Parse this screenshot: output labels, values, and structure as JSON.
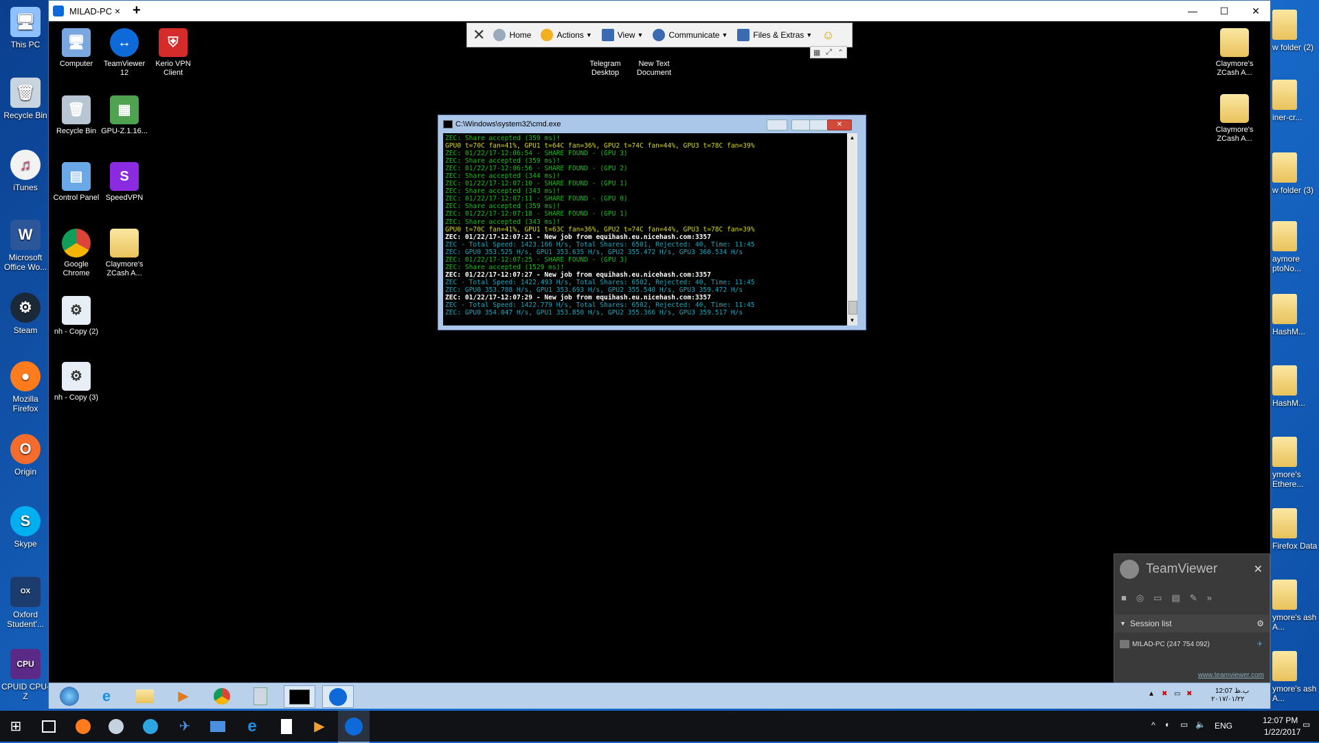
{
  "local_desktop": {
    "left_icons": [
      "This PC",
      "Recycle Bin",
      "iTunes",
      "Microsoft Office Wo...",
      "Steam",
      "Mozilla Firefox",
      "Origin",
      "Skype",
      "Oxford Student'...",
      "CPUID CPU-Z"
    ],
    "right_icons": [
      "w folder (2)",
      "iner-cr...",
      "w folder (3)",
      "aymore ptoNo...",
      "HashM...",
      "HashM...",
      "ymore's Ethere...",
      "Firefox Data",
      "ymore's ash A...",
      "ymore's ash A..."
    ]
  },
  "tv_window": {
    "tab_title": "MILAD-PC",
    "tab_close": "×",
    "new_tab": "+",
    "minimize": "—",
    "maximize": "☐",
    "close": "✕"
  },
  "tv_toolbar": {
    "items": [
      "Home",
      "Actions",
      "View",
      "Communicate",
      "Files & Extras"
    ],
    "smiley": "☺"
  },
  "remote_desktop": {
    "icons": [
      {
        "label": "Computer"
      },
      {
        "label": "TeamViewer 12"
      },
      {
        "label": "Kerio VPN Client"
      },
      {
        "label": "Recycle Bin"
      },
      {
        "label": "GPU-Z.1.16..."
      },
      {
        "label": "Control Panel"
      },
      {
        "label": "SpeedVPN"
      },
      {
        "label": "Google Chrome"
      },
      {
        "label": "Claymore's ZCash A..."
      },
      {
        "label": "nh - Copy (2)"
      },
      {
        "label": "nh - Copy (3)"
      },
      {
        "label": "Telegram Desktop"
      },
      {
        "label": "New Text Document"
      },
      {
        "label": "Claymore's ZCash A..."
      },
      {
        "label": "Claymore's ZCash A..."
      }
    ]
  },
  "cmd": {
    "title": "C:\\Windows\\system32\\cmd.exe",
    "lines": [
      {
        "c": "green",
        "t": "ZEC: Share accepted (359 ms)!"
      },
      {
        "c": "yellow",
        "t": "GPU0 t=70C fan=41%, GPU1 t=64C fan=36%, GPU2 t=74C fan=44%, GPU3 t=78C fan=39%"
      },
      {
        "c": "green",
        "t": "ZEC: 01/22/17-12:06:54 - SHARE FOUND - (GPU 3)"
      },
      {
        "c": "green",
        "t": "ZEC: Share accepted (359 ms)!"
      },
      {
        "c": "green",
        "t": "ZEC: 01/22/17-12:06:56 - SHARE FOUND - (GPU 2)"
      },
      {
        "c": "green",
        "t": "ZEC: Share accepted (344 ms)!"
      },
      {
        "c": "green",
        "t": "ZEC: 01/22/17-12:07:10 - SHARE FOUND - (GPU 1)"
      },
      {
        "c": "green",
        "t": "ZEC: Share accepted (343 ms)!"
      },
      {
        "c": "green",
        "t": "ZEC: 01/22/17-12:07:11 - SHARE FOUND - (GPU 0)"
      },
      {
        "c": "green",
        "t": "ZEC: Share accepted (359 ms)!"
      },
      {
        "c": "green",
        "t": "ZEC: 01/22/17-12:07:18 - SHARE FOUND - (GPU 1)"
      },
      {
        "c": "green",
        "t": "ZEC: Share accepted (343 ms)!"
      },
      {
        "c": "yellow",
        "t": "GPU0 t=70C fan=41%, GPU1 t=63C fan=36%, GPU2 t=74C fan=44%, GPU3 t=78C fan=39%"
      },
      {
        "c": "white",
        "t": "ZEC: 01/22/17-12:07:21 - New job from equihash.eu.nicehash.com:3357"
      },
      {
        "c": "cyan",
        "t": "ZEC - Total Speed: 1423.166 H/s, Total Shares: 6501, Rejected: 40, Time: 11:45"
      },
      {
        "c": "cyan",
        "t": "ZEC: GPU0 353.525 H/s, GPU1 353.635 H/s, GPU2 355.472 H/s, GPU3 360.534 H/s"
      },
      {
        "c": "green",
        "t": "ZEC: 01/22/17-12:07:25 - SHARE FOUND - (GPU 3)"
      },
      {
        "c": "green",
        "t": "ZEC: Share accepted (1529 ms)!"
      },
      {
        "c": "white",
        "t": "ZEC: 01/22/17-12:07:27 - New job from equihash.eu.nicehash.com:3357"
      },
      {
        "c": "cyan",
        "t": "ZEC - Total Speed: 1422.493 H/s, Total Shares: 6502, Rejected: 40, Time: 11:45"
      },
      {
        "c": "cyan",
        "t": "ZEC: GPU0 353.788 H/s, GPU1 353.693 H/s, GPU2 355.540 H/s, GPU3 359.472 H/s"
      },
      {
        "c": "white",
        "t": "ZEC: 01/22/17-12:07:29 - New job from equihash.eu.nicehash.com:3357"
      },
      {
        "c": "cyan",
        "t": "ZEC - Total Speed: 1422.779 H/s, Total Shares: 6502, Rejected: 40, Time: 11:45"
      },
      {
        "c": "cyan",
        "t": "ZEC: GPU0 354.047 H/s, GPU1 353.850 H/s, GPU2 355.366 H/s, GPU3 359.517 H/s"
      }
    ]
  },
  "tv_panel": {
    "title": "TeamViewer",
    "session_list": "Session list",
    "session_entry": "MILAD-PC (247 754 092)",
    "link": "www.teamviewer.com"
  },
  "remote_tray": {
    "time": "12:07 ب.ظ",
    "date": "۲۰۱۷/۰۱/۲۲"
  },
  "local_tray": {
    "lang": "ENG",
    "time": "12:07 PM",
    "date": "1/22/2017"
  }
}
